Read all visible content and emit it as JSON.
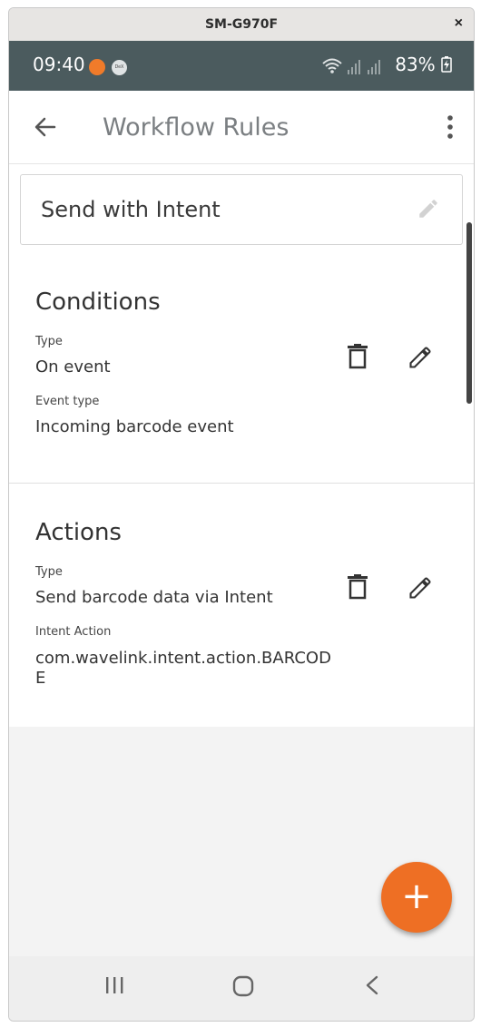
{
  "window": {
    "title": "SM-G970F",
    "close": "×"
  },
  "status": {
    "time": "09:40",
    "dex": "DeX",
    "battery": "83%"
  },
  "appbar": {
    "title": "Workflow Rules"
  },
  "rule": {
    "name": "Send with Intent"
  },
  "conditions": {
    "title": "Conditions",
    "type_label": "Type",
    "type_value": "On event",
    "event_label": "Event type",
    "event_value": "Incoming barcode event"
  },
  "actions": {
    "title": "Actions",
    "type_label": "Type",
    "type_value": "Send barcode data via Intent",
    "intent_label": "Intent Action",
    "intent_value": "com.wavelink.intent.action.BARCODE"
  },
  "fab": {
    "label": "+"
  },
  "colors": {
    "accent": "#ee6f24",
    "statusbar": "#4b5b5e"
  }
}
